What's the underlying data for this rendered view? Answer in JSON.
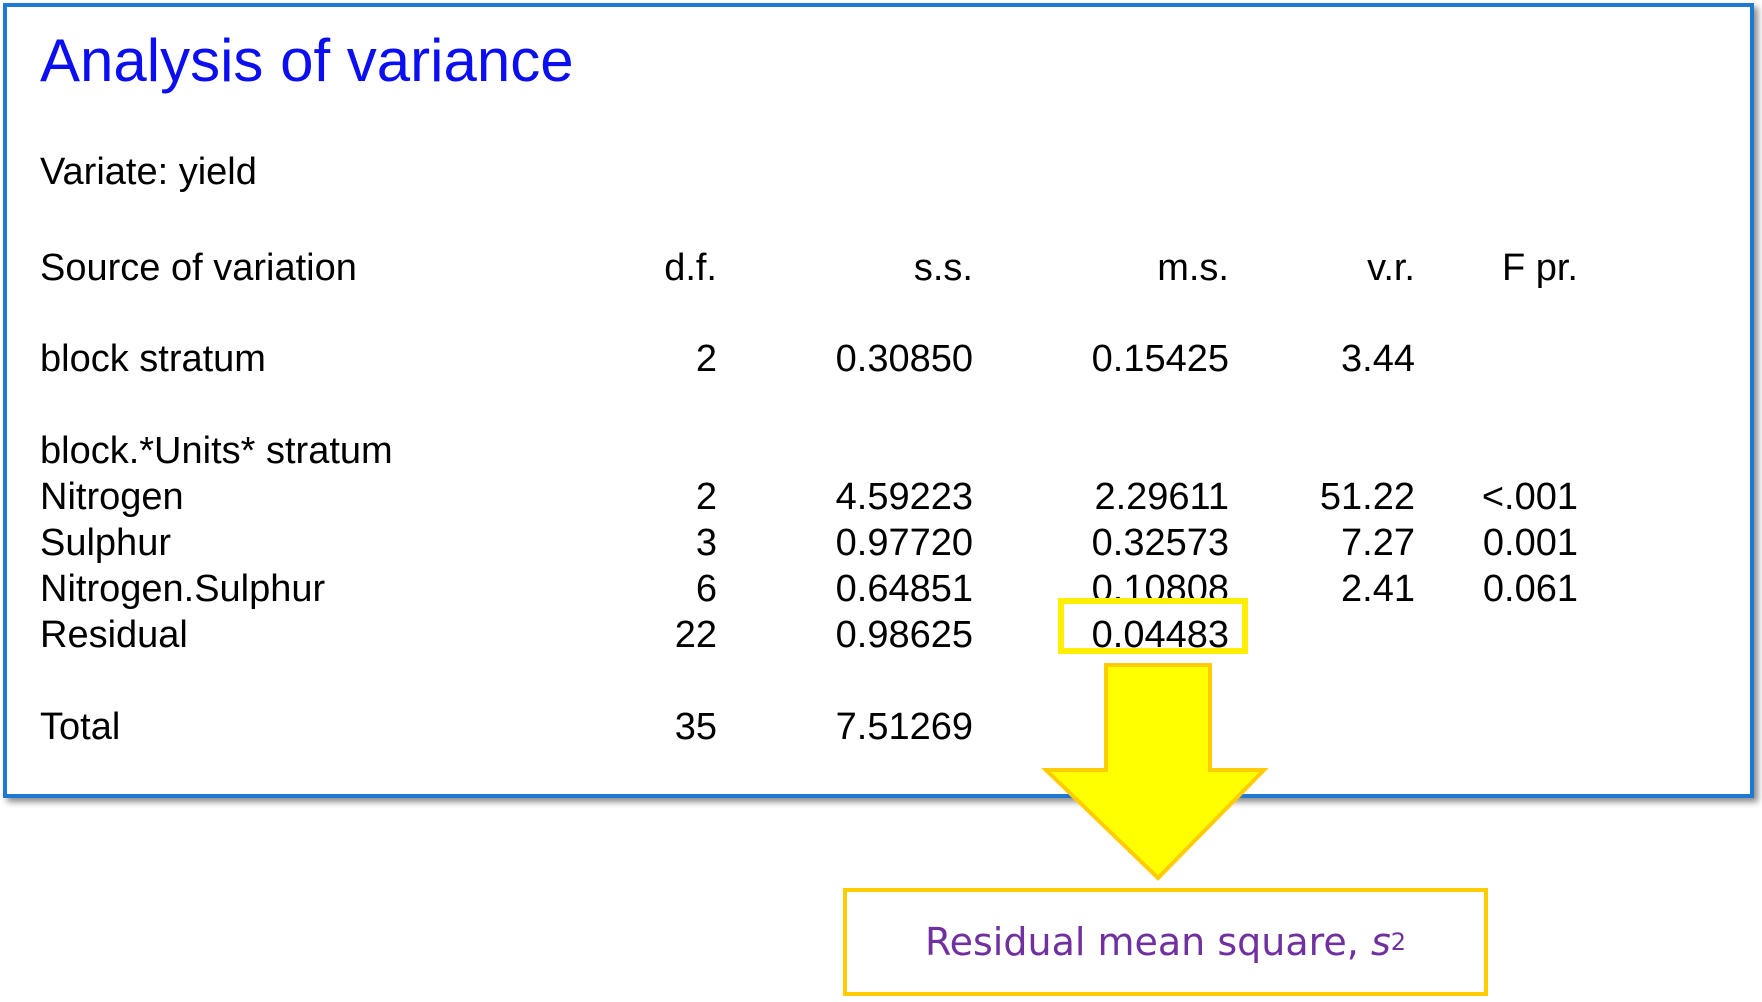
{
  "title": "Analysis of variance",
  "variate": "Variate: yield",
  "header": {
    "source": "Source of variation",
    "df": "d.f.",
    "ss": "s.s.",
    "ms": "m.s.",
    "vr": "v.r.",
    "fpr": "F pr."
  },
  "rows": [
    {
      "source": "block stratum",
      "df": "2",
      "ss": "0.30850",
      "ms": "0.15425",
      "vr": "3.44",
      "fpr": ""
    },
    {
      "source": "block.*Units* stratum",
      "df": "",
      "ss": "",
      "ms": "",
      "vr": "",
      "fpr": ""
    },
    {
      "source": "Nitrogen",
      "df": "2",
      "ss": "4.59223",
      "ms": "2.29611",
      "vr": "51.22",
      "fpr": "<.001"
    },
    {
      "source": "Sulphur",
      "df": "3",
      "ss": "0.97720",
      "ms": "0.32573",
      "vr": "7.27",
      "fpr": "0.001"
    },
    {
      "source": "Nitrogen.Sulphur",
      "df": "6",
      "ss": "0.64851",
      "ms": "0.10808",
      "vr": "2.41",
      "fpr": "0.061"
    },
    {
      "source": "Residual",
      "df": "22",
      "ss": "0.98625",
      "ms": "0.04483",
      "vr": "",
      "fpr": ""
    },
    {
      "source": "Total",
      "df": "35",
      "ss": "7.51269",
      "ms": "",
      "vr": "",
      "fpr": ""
    }
  ],
  "callout": {
    "text": "Residual mean square, ",
    "symbol": "s",
    "superscript": "2"
  },
  "colors": {
    "title": "#0a0ef0",
    "panel_border": "#1f78d1",
    "highlight": "#ffee00",
    "arrow_fill": "#ffff00",
    "arrow_stroke": "#ffcc00",
    "callout_text": "#7030a0"
  }
}
